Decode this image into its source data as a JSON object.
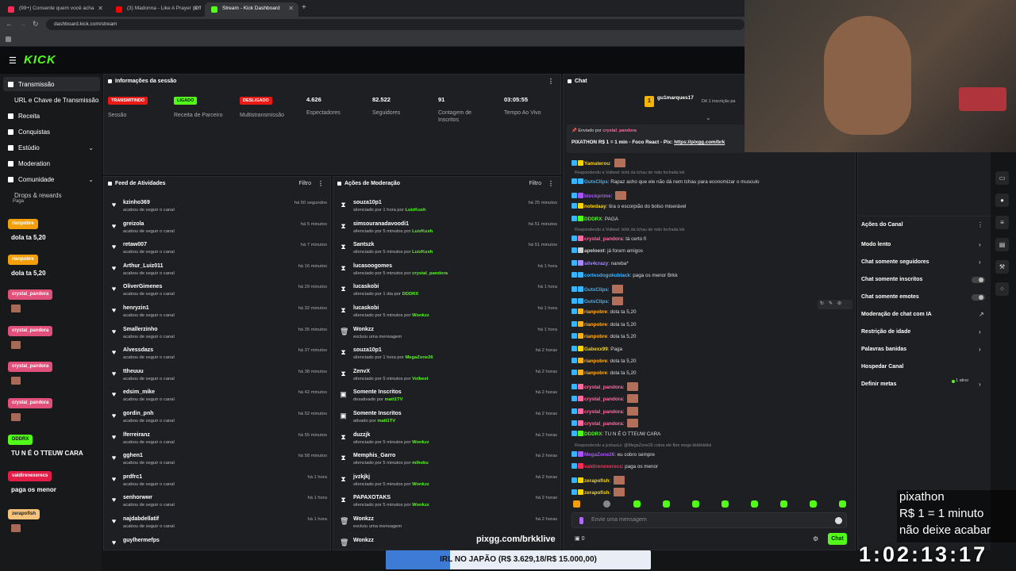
{
  "browser": {
    "tabs": [
      {
        "label": "(99+) Consente quem você acha",
        "color": "#ff2d55"
      },
      {
        "label": "(3) Madonna - Like A Prayer (Off",
        "color": "#ff0000"
      },
      {
        "label": "Stream - Kick Dashboard",
        "color": "#53fc18"
      }
    ],
    "url": "dashboard.kick.com/stream"
  },
  "brand": {
    "logo": "KICK",
    "accent": "#53fc18"
  },
  "sidebar": {
    "items": [
      {
        "label": "Transmissão",
        "icon": "broadcast-icon"
      },
      {
        "label": "URL e Chave de Transmissão",
        "icon": ""
      },
      {
        "label": "Receita",
        "icon": "money-icon"
      },
      {
        "label": "Conquistas",
        "icon": "trophy-icon"
      },
      {
        "label": "Estúdio",
        "icon": "studio-icon"
      },
      {
        "label": "Moderation",
        "icon": "shield-icon"
      },
      {
        "label": "Comunidade",
        "icon": "community-icon"
      },
      {
        "label": "Drops & rewards",
        "icon": "gift-icon"
      }
    ],
    "extra": "Paga"
  },
  "session": {
    "title": "Informações da sessão",
    "stats": [
      {
        "badge": "TRANSMITINDO",
        "badge_color": "#e91916",
        "label": "Sessão"
      },
      {
        "badge": "LIGADO",
        "badge_color": "#53fc18",
        "label": "Receita de Parceiro"
      },
      {
        "badge": "DESLIGADO",
        "badge_color": "#e91916",
        "label": "Multistransmissão"
      },
      {
        "value": "4.626",
        "label": "Espectadores"
      },
      {
        "value": "82.522",
        "label": "Seguidores"
      },
      {
        "value": "91",
        "label": "Contagem de Inscritos"
      },
      {
        "value": "03:05:55",
        "label": "Tempo Ao Vivo"
      }
    ]
  },
  "activity": {
    "title": "Feed de Atividades",
    "filter": "Filtro",
    "rows": [
      {
        "name": "kzinho369",
        "sub": "acabou de seguir o canal",
        "time": "há 50 segundos"
      },
      {
        "name": "greizola",
        "sub": "acabou de seguir o canal",
        "time": "há 5 minutos"
      },
      {
        "name": "retaw007",
        "sub": "acabou de seguir o canal",
        "time": "há 7 minutos"
      },
      {
        "name": "Arthur_Luiz011",
        "sub": "acabou de seguir o canal",
        "time": "há 16 minutos"
      },
      {
        "name": "OliverGimenes",
        "sub": "acabou de seguir o canal",
        "time": "há 29 minutos"
      },
      {
        "name": "henryzin1",
        "sub": "acabou de seguir o canal",
        "time": "há 32 minutos"
      },
      {
        "name": "Smallerzinho",
        "sub": "acabou de seguir o canal",
        "time": "há 35 minutos"
      },
      {
        "name": "Alvessdazs",
        "sub": "acabou de seguir o canal",
        "time": "há 37 minutos"
      },
      {
        "name": "ttheuuu",
        "sub": "acabou de seguir o canal",
        "time": "há 38 minutos"
      },
      {
        "name": "edsim_mike",
        "sub": "acabou de seguir o canal",
        "time": "há 42 minutos"
      },
      {
        "name": "gordin_pnh",
        "sub": "acabou de seguir o canal",
        "time": "há 52 minutos"
      },
      {
        "name": "lferreiranz",
        "sub": "acabou de seguir o canal",
        "time": "há 55 minutos"
      },
      {
        "name": "gghen1",
        "sub": "acabou de seguir o canal",
        "time": "há 58 minutos"
      },
      {
        "name": "prdfrc1",
        "sub": "acabou de seguir o canal",
        "time": "há 1 hora"
      },
      {
        "name": "senhorwwr",
        "sub": "acabou de seguir o canal",
        "time": "há 1 hora"
      },
      {
        "name": "najdabdellatif",
        "sub": "acabou de seguir o canal",
        "time": "há 1 hora"
      },
      {
        "name": "guylhermefps",
        "sub": "",
        "time": ""
      }
    ]
  },
  "moderation": {
    "title": "Ações de Moderação",
    "filter": "Filtro",
    "rows": [
      {
        "name": "souza10p1",
        "sub": "silenciado por 1 hora por",
        "mod": "LuizKush",
        "time": "há 25 minutos",
        "icon": "hourglass-icon"
      },
      {
        "name": "simsouranadavoodi1",
        "sub": "silenciado por 5 minutos por",
        "mod": "LuizKush",
        "time": "há 51 minutos",
        "icon": "hourglass-icon"
      },
      {
        "name": "Santszk",
        "sub": "silenciado por 5 minutos por",
        "mod": "LuizKush",
        "time": "há 51 minutos",
        "icon": "hourglass-icon"
      },
      {
        "name": "lucasoogomes",
        "sub": "silenciado por 5 minutos por",
        "mod": "crystal_pandora",
        "time": "há 1 hora",
        "icon": "hourglass-icon"
      },
      {
        "name": "lucaskobi",
        "sub": "silenciado por 1 dia por",
        "mod": "DDDRX",
        "time": "há 1 hora",
        "icon": "hourglass-icon"
      },
      {
        "name": "lucaskobi",
        "sub": "silenciado por 5 minutos por",
        "mod": "Wonkzz",
        "time": "há 1 hora",
        "icon": "hourglass-icon"
      },
      {
        "name": "Wonkzz",
        "sub": "excluiu uma mensagem",
        "mod": "",
        "time": "há 1 hora",
        "icon": "trash-icon"
      },
      {
        "name": "souza10p1",
        "sub": "silenciado por 1 hora por",
        "mod": "MegaZone26",
        "time": "há 2 horas",
        "icon": "hourglass-icon"
      },
      {
        "name": "ZenvX",
        "sub": "silenciado por 5 minutos por",
        "mod": "Volbeel",
        "time": "há 2 horas",
        "icon": "hourglass-icon"
      },
      {
        "name": "Somente Inscritos",
        "sub": "desativado por",
        "mod": "matt1TV",
        "time": "há 2 horas",
        "icon": "gift-icon"
      },
      {
        "name": "Somente Inscritos",
        "sub": "ativado por",
        "mod": "matt1TV",
        "time": "há 2 horas",
        "icon": "gift-icon"
      },
      {
        "name": "duzzjk",
        "sub": "silenciado por 5 minutos por",
        "mod": "Wonkzz",
        "time": "há 2 horas",
        "icon": "hourglass-icon"
      },
      {
        "name": "Memphis_Garro",
        "sub": "silenciado por 5 minutos por",
        "mod": "mihoku",
        "time": "há 2 horas",
        "icon": "hourglass-icon"
      },
      {
        "name": "jvzkjkj",
        "sub": "silenciado por 5 minutos por",
        "mod": "Wonkzz",
        "time": "há 2 horas",
        "icon": "hourglass-icon"
      },
      {
        "name": "PAPAXOTAKS",
        "sub": "silenciado por 5 minutos por",
        "mod": "Wonkzz",
        "time": "há 2 horas",
        "icon": "hourglass-icon"
      },
      {
        "name": "Wonkzz",
        "sub": "excluiu uma mensagem",
        "mod": "",
        "time": "há 2 horas",
        "icon": "trash-icon"
      },
      {
        "name": "Wonkzz",
        "sub": "",
        "mod": "",
        "time": "",
        "icon": "trash-icon"
      }
    ]
  },
  "chat": {
    "title": "Chat",
    "top_gifter": {
      "rank": "1",
      "name": "gu1marques17",
      "note": "Dê 1 inscrição pa"
    },
    "pinned": {
      "by_label": "Enviado por",
      "by": "crystal_pandora",
      "text": "PIXATHON R$ 1 = 1 min - Foco React - Pix:",
      "link": "https://pixgg.com/brk"
    },
    "messages": [
      {
        "reply": "",
        "user": "Yamaterou",
        "color": "#ffd400",
        "text": "",
        "emote": true
      },
      {
        "reply": "Respondendo a Volbeel: brkk da tchau de mão fechada lek",
        "user": "GutsClips",
        "color": "#3ab4ff",
        "text": "Rapaz acho que ele não dá nem tchau para economizar o musculo",
        "emote": false
      },
      {
        "reply": "",
        "user": "blockprime",
        "color": "#a855f7",
        "text": "",
        "emote": true
      },
      {
        "reply": "",
        "user": "notedaay",
        "color": "#ffd400",
        "text": "tira o escorpião do bolso miserável",
        "emote": false
      },
      {
        "reply": "",
        "user": "DDDRX",
        "color": "#53fc18",
        "text": "PAGA",
        "emote": false
      },
      {
        "reply": "Respondendo a Volbeel: brkk da tchau de mão fechada lek",
        "user": "crystal_pandora",
        "color": "#ff6b9d",
        "text": "tá certo fi",
        "emote": false
      },
      {
        "reply": "",
        "user": "apeloext",
        "color": "#cfcfcf",
        "text": "já foram amigos",
        "emote": false
      },
      {
        "reply": "",
        "user": "silv4crazy",
        "color": "#a78bfa",
        "text": "nareba*",
        "emote": false
      },
      {
        "reply": "",
        "user": "cortesdogokublack",
        "color": "#3ab4ff",
        "text": "paga os menor Brkk",
        "emote": false
      },
      {
        "reply": "",
        "user": "GutsClips",
        "color": "#3ab4ff",
        "text": "",
        "emote": true
      },
      {
        "reply": "",
        "user": "GutsClips",
        "color": "#3ab4ff",
        "text": "",
        "emote": true
      },
      {
        "reply": "",
        "user": "rianpobre",
        "color": "#ffb020",
        "text": "dola ta 5,20",
        "emote": false
      },
      {
        "reply": "",
        "user": "rianpobre",
        "color": "#ffb020",
        "text": "dola ta 5,20",
        "emote": false
      },
      {
        "reply": "",
        "user": "rianpobre",
        "color": "#ffb020",
        "text": "dola ta 5,20",
        "emote": false
      },
      {
        "reply": "",
        "user": "Gabexx99",
        "color": "#ffd400",
        "text": "Paga",
        "emote": false
      },
      {
        "reply": "",
        "user": "rianpobre",
        "color": "#ffb020",
        "text": "dola ta 5,20",
        "emote": false
      },
      {
        "reply": "",
        "user": "rianpobre",
        "color": "#ffb020",
        "text": "dola ta 5,20",
        "emote": false
      },
      {
        "reply": "",
        "user": "crystal_pandora",
        "color": "#ff6b9d",
        "text": "",
        "emote": true
      },
      {
        "reply": "",
        "user": "crystal_pandora",
        "color": "#ff6b9d",
        "text": "",
        "emote": true
      },
      {
        "reply": "",
        "user": "crystal_pandora",
        "color": "#ff6b9d",
        "text": "",
        "emote": true
      },
      {
        "reply": "",
        "user": "crystal_pandora",
        "color": "#ff6b9d",
        "text": "",
        "emote": true
      },
      {
        "reply": "",
        "user": "DDDRX",
        "color": "#53fc18",
        "text": "TU N É O TTEUW CARA",
        "emote": false
      },
      {
        "reply": "Respondendo a jvzkasLz: @MegaZone26 cobra ele fbm mega kkkkkkkkk",
        "user": "MegaZone26",
        "color": "#a855f7",
        "text": "eu cobro sempre",
        "emote": false
      },
      {
        "reply": "",
        "user": "valdirenexerecs",
        "color": "#ff2d55",
        "text": "paga os menor",
        "emote": false
      },
      {
        "reply": "",
        "user": "zerapofish",
        "color": "#ffd400",
        "text": "",
        "emote": true
      },
      {
        "reply": "",
        "user": "zerapofish",
        "color": "#ffd400",
        "text": "",
        "emote": true
      }
    ],
    "input_placeholder": "Envie uma mensagem",
    "send_label": "Chat",
    "points": "0"
  },
  "channel_actions": {
    "title": "Ações do Canal",
    "items": [
      {
        "label": "Modo lento",
        "control": "arrow"
      },
      {
        "label": "Chat somente seguidores",
        "control": "arrow"
      },
      {
        "label": "Chat somente inscritos",
        "control": "toggle"
      },
      {
        "label": "Chat somente emotes",
        "control": "toggle"
      },
      {
        "label": "Moderação de chat com IA",
        "control": "external"
      },
      {
        "label": "Restrição de idade",
        "control": "arrow"
      },
      {
        "label": "Palavras banidas",
        "control": "arrow"
      },
      {
        "label": "Hospedar Canal",
        "control": ""
      },
      {
        "label": "Definir metas",
        "control": "arrow"
      }
    ],
    "meta_status": "1 ativo"
  },
  "overlay_chat": [
    {
      "user": "rianpobre",
      "color": "#f59e0b",
      "msg": "dola ta 5,20",
      "emote": false
    },
    {
      "user": "rianpobre",
      "color": "#f59e0b",
      "msg": "dola ta 5,20",
      "emote": false
    },
    {
      "user": "crystal_pandora",
      "color": "#e0507a",
      "msg": "",
      "emote": true
    },
    {
      "user": "crystal_pandora",
      "color": "#e0507a",
      "msg": "",
      "emote": true
    },
    {
      "user": "crystal_pandora",
      "color": "#e0507a",
      "msg": "",
      "emote": true
    },
    {
      "user": "crystal_pandora",
      "color": "#e0507a",
      "msg": "",
      "emote": true
    },
    {
      "user": "DDDRX",
      "color": "#53fc18",
      "msg": "TU N É O TTEUW CARA",
      "emote": false
    },
    {
      "user": "valdirenexerecs",
      "color": "#e11d48",
      "msg": "paga os menor",
      "emote": false
    },
    {
      "user": "zerapofish",
      "color": "#f4c27a",
      "msg": "",
      "emote": true
    }
  ],
  "stream_overlay": {
    "pix_url": "pixgg.com/brkklive",
    "goal_text": "IRL NO JAPÃO (R$ 3.629,18/R$ 15.000,00)",
    "goal_progress": 0.242,
    "pixathon_lines": [
      "pixathon",
      "R$ 1 = 1 minuto",
      "não deixe acabar"
    ],
    "timer": "1:02:13:17"
  }
}
